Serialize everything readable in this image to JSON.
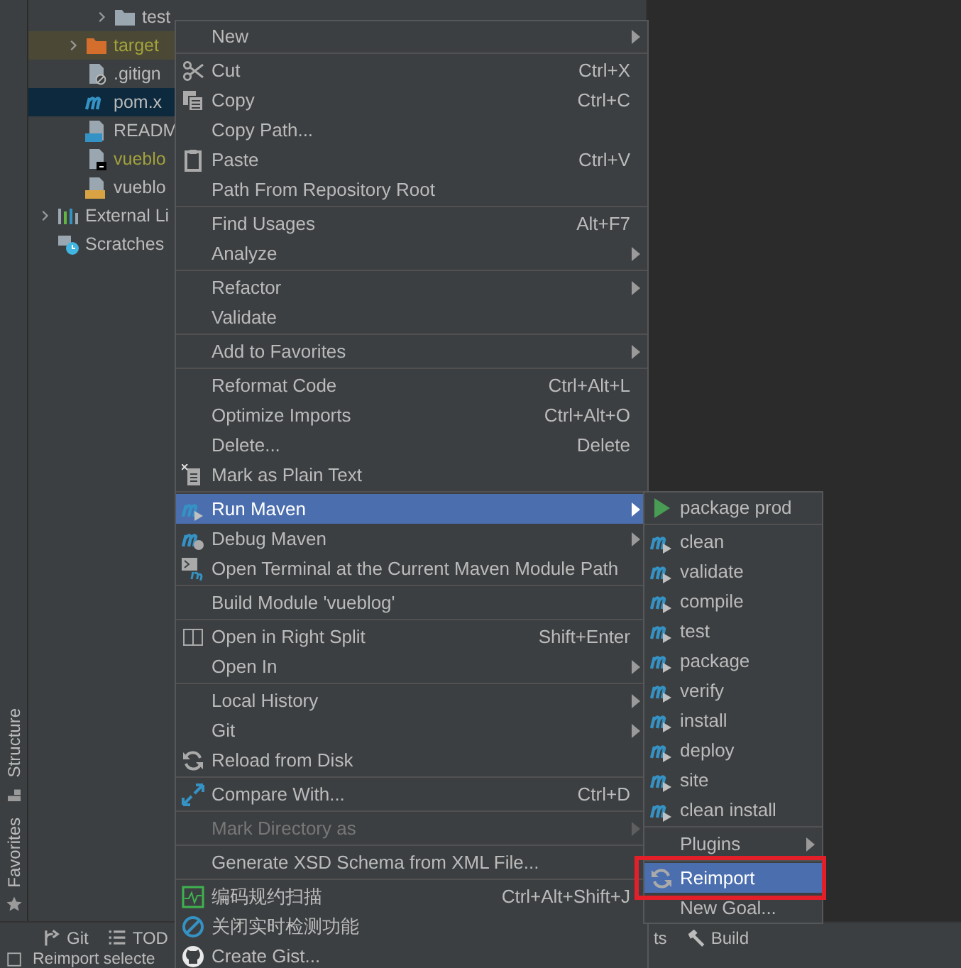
{
  "project_tree": {
    "nodes": [
      {
        "children": [
          {
            "children": [
              {
                "label": "test",
                "kind": "folder",
                "expandable": true,
                "selected": false,
                "ignored": false
              }
            ]
          },
          {
            "label": "target",
            "kind": "excluded-folder",
            "expandable": true,
            "selected": false,
            "ignored": true
          },
          {
            "label": ".gitign",
            "kind": "gitignore-file",
            "expandable": false,
            "selected": false,
            "ignored": false
          },
          {
            "label": "pom.x",
            "kind": "maven-file",
            "expandable": false,
            "selected": true,
            "ignored": false
          },
          {
            "label": "READM",
            "kind": "markdown-file",
            "expandable": false,
            "selected": false,
            "ignored": false
          },
          {
            "label": "vueblo",
            "kind": "log-file",
            "expandable": false,
            "selected": false,
            "ignored": true
          },
          {
            "label": "vueblo",
            "kind": "sql-file",
            "expandable": false,
            "selected": false,
            "ignored": false
          }
        ]
      },
      {
        "label": "External Li",
        "kind": "libraries",
        "expandable": true,
        "selected": false,
        "ignored": false
      },
      {
        "label": "Scratches",
        "kind": "scratches",
        "expandable": false,
        "selected": false,
        "ignored": false
      }
    ]
  },
  "left_tool_strip": [
    {
      "label": "Structure"
    },
    {
      "label": "Favorites"
    }
  ],
  "context_menu": {
    "groups": [
      [
        {
          "label": "New",
          "submenu": true,
          "selected": false,
          "disabled": false
        }
      ],
      [
        {
          "label": "Cut",
          "shortcut": "Ctrl+X",
          "submenu": false,
          "selected": false,
          "disabled": false
        },
        {
          "label": "Copy",
          "shortcut": "Ctrl+C",
          "submenu": false,
          "selected": false,
          "disabled": false
        },
        {
          "label": "Copy Path...",
          "submenu": false,
          "selected": false,
          "disabled": false
        },
        {
          "label": "Paste",
          "shortcut": "Ctrl+V",
          "submenu": false,
          "selected": false,
          "disabled": false
        },
        {
          "label": "Path From Repository Root",
          "submenu": false,
          "selected": false,
          "disabled": false
        }
      ],
      [
        {
          "label": "Find Usages",
          "shortcut": "Alt+F7",
          "submenu": false,
          "selected": false,
          "disabled": false
        },
        {
          "label": "Analyze",
          "submenu": true,
          "selected": false,
          "disabled": false
        }
      ],
      [
        {
          "label": "Refactor",
          "submenu": true,
          "selected": false,
          "disabled": false
        },
        {
          "label": "Validate",
          "submenu": false,
          "selected": false,
          "disabled": false
        }
      ],
      [
        {
          "label": "Add to Favorites",
          "submenu": true,
          "selected": false,
          "disabled": false
        }
      ],
      [
        {
          "label": "Reformat Code",
          "shortcut": "Ctrl+Alt+L",
          "submenu": false,
          "selected": false,
          "disabled": false
        },
        {
          "label": "Optimize Imports",
          "shortcut": "Ctrl+Alt+O",
          "submenu": false,
          "selected": false,
          "disabled": false
        },
        {
          "label": "Delete...",
          "shortcut": "Delete",
          "submenu": false,
          "selected": false,
          "disabled": false
        },
        {
          "label": "Mark as Plain Text",
          "submenu": false,
          "selected": false,
          "disabled": false
        }
      ],
      [
        {
          "label": "Run Maven",
          "submenu": true,
          "selected": true,
          "disabled": false
        },
        {
          "label": "Debug Maven",
          "submenu": true,
          "selected": false,
          "disabled": false
        },
        {
          "label": "Open Terminal at the Current Maven Module Path",
          "submenu": false,
          "selected": false,
          "disabled": false
        }
      ],
      [
        {
          "label": "Build Module 'vueblog'",
          "submenu": false,
          "selected": false,
          "disabled": false
        }
      ],
      [
        {
          "label": "Open in Right Split",
          "shortcut": "Shift+Enter",
          "submenu": false,
          "selected": false,
          "disabled": false
        },
        {
          "label": "Open In",
          "submenu": true,
          "selected": false,
          "disabled": false
        }
      ],
      [
        {
          "label": "Local History",
          "submenu": true,
          "selected": false,
          "disabled": false
        },
        {
          "label": "Git",
          "submenu": true,
          "selected": false,
          "disabled": false
        },
        {
          "label": "Reload from Disk",
          "submenu": false,
          "selected": false,
          "disabled": false
        }
      ],
      [
        {
          "label": "Compare With...",
          "shortcut": "Ctrl+D",
          "submenu": false,
          "selected": false,
          "disabled": false
        }
      ],
      [
        {
          "label": "Mark Directory as",
          "submenu": true,
          "selected": false,
          "disabled": true
        }
      ],
      [
        {
          "label": "Generate XSD Schema from XML File...",
          "submenu": false,
          "selected": false,
          "disabled": false
        }
      ],
      [
        {
          "label": "编码规约扫描",
          "shortcut": "Ctrl+Alt+Shift+J",
          "submenu": false,
          "selected": false,
          "disabled": false
        },
        {
          "label": "关闭实时检测功能",
          "submenu": false,
          "selected": false,
          "disabled": false
        },
        {
          "label": "Create Gist...",
          "submenu": false,
          "selected": false,
          "disabled": false
        }
      ]
    ]
  },
  "maven_submenu": {
    "groups": [
      [
        {
          "label": "package prod",
          "kind": "run-config",
          "submenu": false,
          "selected": false,
          "outlined": false
        }
      ],
      [
        {
          "label": "clean",
          "kind": "goal",
          "submenu": false,
          "selected": false,
          "outlined": false
        },
        {
          "label": "validate",
          "kind": "goal",
          "submenu": false,
          "selected": false,
          "outlined": false
        },
        {
          "label": "compile",
          "kind": "goal",
          "submenu": false,
          "selected": false,
          "outlined": false
        },
        {
          "label": "test",
          "kind": "goal",
          "submenu": false,
          "selected": false,
          "outlined": false
        },
        {
          "label": "package",
          "kind": "goal",
          "submenu": false,
          "selected": false,
          "outlined": false
        },
        {
          "label": "verify",
          "kind": "goal",
          "submenu": false,
          "selected": false,
          "outlined": false
        },
        {
          "label": "install",
          "kind": "goal",
          "submenu": false,
          "selected": false,
          "outlined": false
        },
        {
          "label": "deploy",
          "kind": "goal",
          "submenu": false,
          "selected": false,
          "outlined": false
        },
        {
          "label": "site",
          "kind": "goal",
          "submenu": false,
          "selected": false,
          "outlined": false
        },
        {
          "label": "clean install",
          "kind": "goal",
          "submenu": false,
          "selected": false,
          "outlined": false
        }
      ],
      [
        {
          "label": "Plugins",
          "kind": "plain",
          "submenu": true,
          "selected": false,
          "outlined": false
        }
      ],
      [
        {
          "label": "Reimport",
          "kind": "reimport",
          "submenu": false,
          "selected": true,
          "outlined": true
        },
        {
          "label": "New Goal...",
          "kind": "plain",
          "submenu": false,
          "selected": false,
          "outlined": false
        }
      ]
    ]
  },
  "bottom_toolbar": [
    {
      "label": "Git",
      "kind": "git"
    },
    {
      "label": "TOD",
      "kind": "todo"
    },
    {
      "label": "ts",
      "kind": "plain"
    },
    {
      "label": "Build",
      "kind": "build"
    }
  ],
  "status_bar": {
    "text": "Reimport selecte"
  }
}
